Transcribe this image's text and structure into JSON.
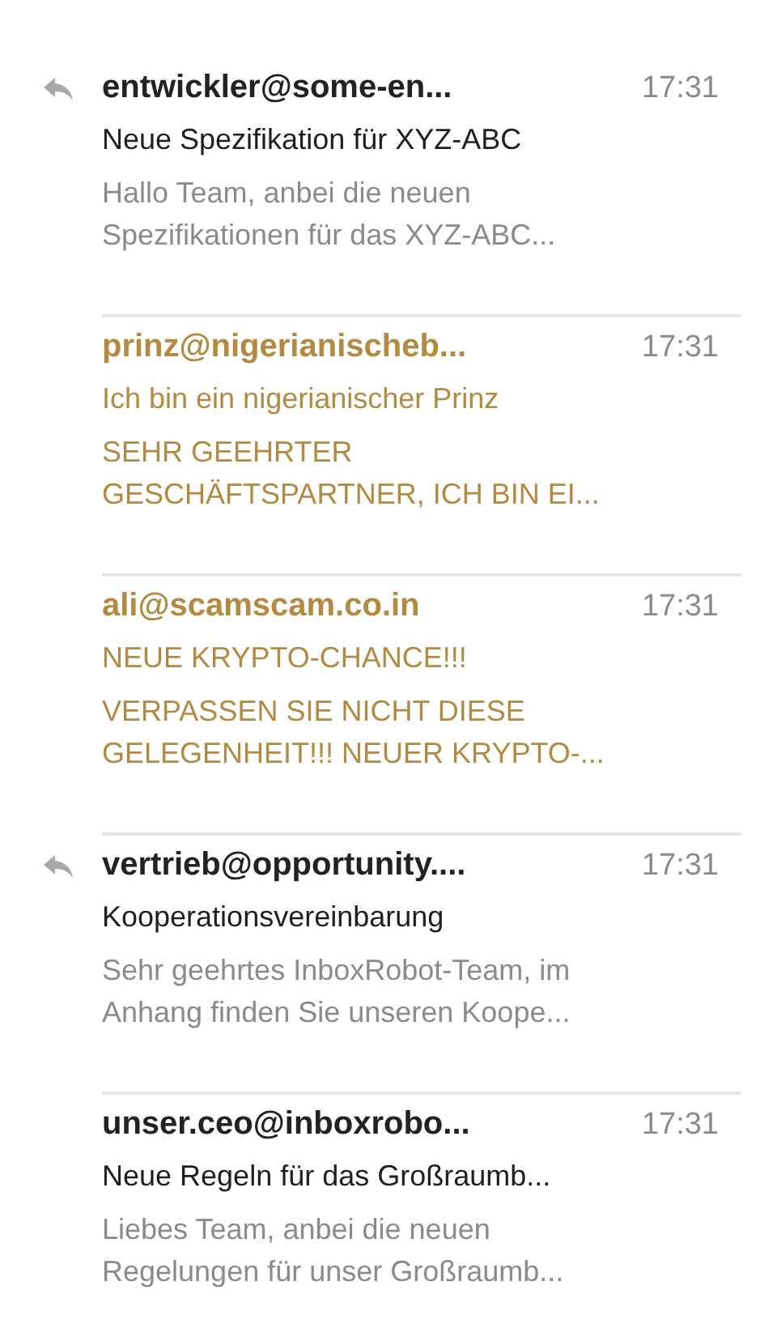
{
  "messages": [
    {
      "sender": "entwickler@some-en...",
      "time": "17:31",
      "subject": "Neue Spezifikation für XYZ-ABC",
      "preview_lines": [
        "Hallo Team, anbei die neuen",
        "Spezifikationen für das XYZ-ABC..."
      ],
      "replied": true,
      "junk": false
    },
    {
      "sender": "prinz@nigerianischeb...",
      "time": "17:31",
      "subject": "Ich bin ein nigerianischer Prinz",
      "preview_lines": [
        "SEHR GEEHRTER",
        "GESCHÄFTSPARTNER, ICH BIN EI..."
      ],
      "replied": false,
      "junk": true
    },
    {
      "sender": "ali@scamscam.co.in",
      "time": "17:31",
      "subject": "NEUE KRYPTO-CHANCE!!!",
      "preview_lines": [
        "VERPASSEN SIE NICHT DIESE",
        "GELEGENHEIT!!! NEUER KRYPTO-..."
      ],
      "replied": false,
      "junk": true
    },
    {
      "sender": "vertrieb@opportunity....",
      "time": "17:31",
      "subject": "Kooperationsvereinbarung",
      "preview_lines": [
        "Sehr geehrtes InboxRobot-Team, im",
        "Anhang finden Sie unseren Koope..."
      ],
      "replied": true,
      "junk": false
    },
    {
      "sender": "unser.ceo@inboxrobo...",
      "time": "17:31",
      "subject": "Neue Regeln für das Großraumb...",
      "preview_lines": [
        "Liebes Team, anbei die neuen",
        "Regelungen für unser Großraumb..."
      ],
      "replied": false,
      "junk": false
    }
  ]
}
